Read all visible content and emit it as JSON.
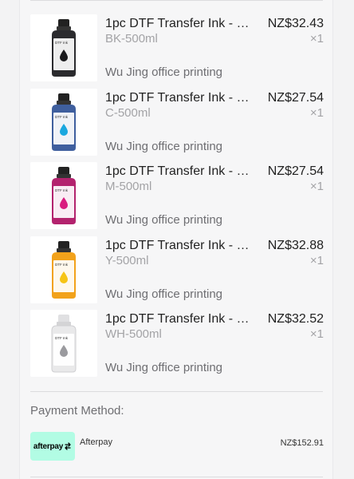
{
  "items": [
    {
      "title": "1pc DTF Transfer Ink - 50...",
      "variant": "BK-500ml",
      "seller": "Wu Jing office printing",
      "price": "NZ$32.43",
      "qty": "×1",
      "ink_color": "#2b2b2e",
      "label_color": "#1a1a1c",
      "bottle_label": "DTF Ink"
    },
    {
      "title": "1pc DTF Transfer Ink - 50...",
      "variant": "C-500ml",
      "seller": "Wu Jing office printing",
      "price": "NZ$27.54",
      "qty": "×1",
      "ink_color": "#3f5f9e",
      "label_color": "#1aa7df",
      "bottle_label": "DTF Ink"
    },
    {
      "title": "1pc DTF Transfer Ink - 50...",
      "variant": "M-500ml",
      "seller": "Wu Jing office printing",
      "price": "NZ$27.54",
      "qty": "×1",
      "ink_color": "#b3236e",
      "label_color": "#d91b7f",
      "bottle_label": "DTF Ink"
    },
    {
      "title": "1pc DTF Transfer Ink - 50...",
      "variant": "Y-500ml",
      "seller": "Wu Jing office printing",
      "price": "NZ$32.88",
      "qty": "×1",
      "ink_color": "#f2a21b",
      "label_color": "#f6c416",
      "bottle_label": "DTF Ink"
    },
    {
      "title": "1pc DTF Transfer Ink - 50...",
      "variant": "WH-500ml",
      "seller": "Wu Jing office printing",
      "price": "NZ$32.52",
      "qty": "×1",
      "ink_color": "#e9e9ea",
      "label_color": "#d6d6d8",
      "bottle_label": "DTF Ink"
    }
  ],
  "payment": {
    "label": "Payment Method:",
    "logo_text": "afterpay",
    "logo_bg": "#b2fce4",
    "method": "Afterpay",
    "total": "NZ$152.91"
  }
}
